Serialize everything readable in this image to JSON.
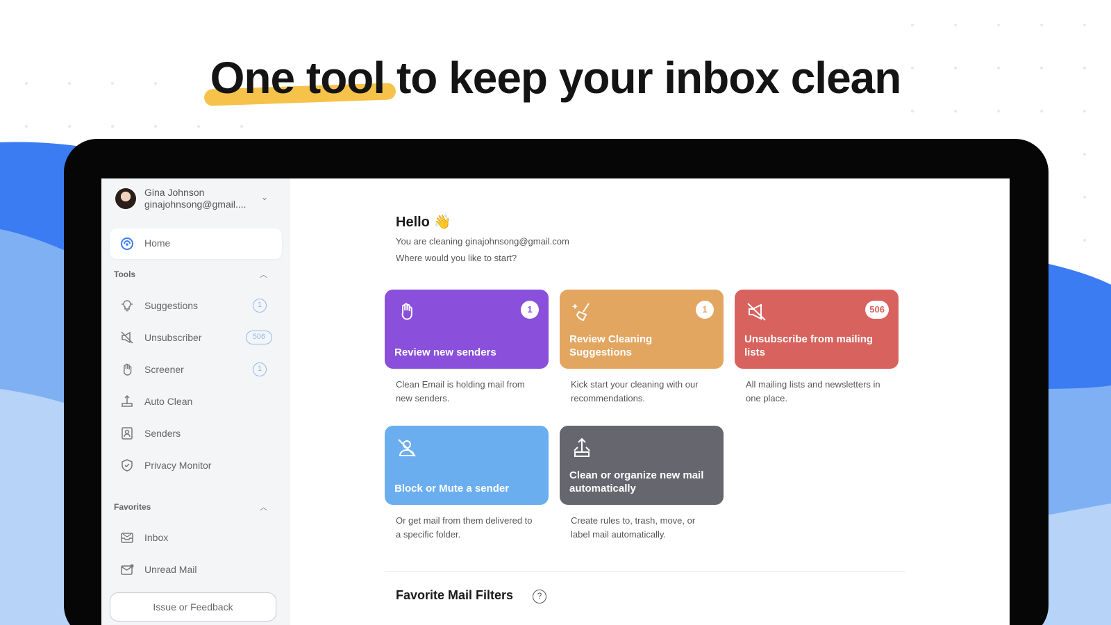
{
  "headline": "One tool to keep your inbox clean",
  "colors": {
    "accent_highlight": "#f6c24a",
    "wave_blue": "#3b7cf2",
    "wave_light": "#8ab6f5",
    "card_purple": "#8a4fdb",
    "card_orange": "#e2a661",
    "card_red": "#d8625e",
    "card_blue": "#6aaef0",
    "card_gray": "#66666f"
  },
  "sidebar": {
    "account": {
      "name": "Gina Johnson",
      "email": "ginajohnsong@gmail...."
    },
    "home": {
      "label": "Home",
      "icon": "home-icon"
    },
    "tools_title": "Tools",
    "tools": [
      {
        "label": "Suggestions",
        "icon": "lightbulb-icon",
        "badge": "1"
      },
      {
        "label": "Unsubscriber",
        "icon": "unsubscribe-icon",
        "badge": "506"
      },
      {
        "label": "Screener",
        "icon": "hand-icon",
        "badge": "1"
      },
      {
        "label": "Auto Clean",
        "icon": "auto-clean-icon",
        "badge": ""
      },
      {
        "label": "Senders",
        "icon": "senders-icon",
        "badge": ""
      },
      {
        "label": "Privacy Monitor",
        "icon": "shield-icon",
        "badge": ""
      }
    ],
    "favorites_title": "Favorites",
    "favorites": [
      {
        "label": "Inbox",
        "icon": "inbox-icon"
      },
      {
        "label": "Unread Mail",
        "icon": "unread-mail-icon"
      }
    ],
    "feedback_label": "Issue or Feedback"
  },
  "main": {
    "hello": "Hello 👋",
    "subtitle_1": "You are cleaning ginajohnsong@gmail.com",
    "subtitle_2": "Where would you like to start?",
    "cards": [
      {
        "title": "Review new senders",
        "badge": "1",
        "icon": "hand-icon",
        "description": "Clean Email is holding mail from new senders."
      },
      {
        "title": "Review Cleaning Suggestions",
        "badge": "1",
        "icon": "sparkle-broom-icon",
        "description": "Kick start your cleaning with our recommendations."
      },
      {
        "title": "Unsubscribe from mailing lists",
        "badge": "506",
        "icon": "mute-megaphone-icon",
        "description": "All mailing lists and newsletters in one place."
      },
      {
        "title": "Block or Mute a sender",
        "badge": "",
        "icon": "block-user-icon",
        "description": "Or get mail from them delivered to a specific folder."
      },
      {
        "title": "Clean or organize new mail automatically",
        "badge": "",
        "icon": "auto-organize-icon",
        "description": "Create rules to, trash, move, or label mail automatically."
      }
    ],
    "favorite_filters_title": "Favorite Mail Filters",
    "help_icon": "?"
  }
}
